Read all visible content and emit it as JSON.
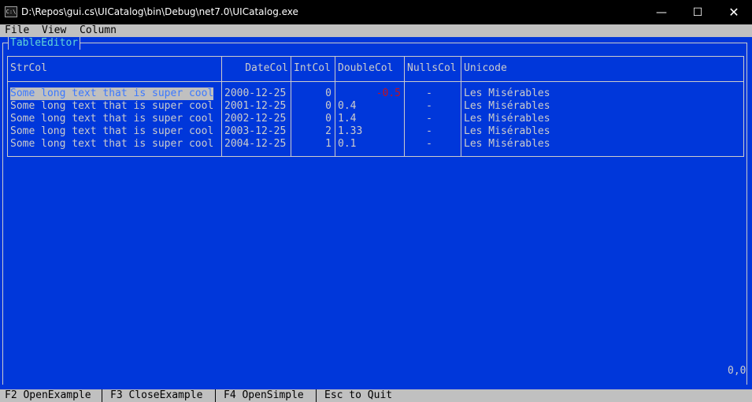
{
  "window": {
    "title": "D:\\Repos\\gui.cs\\UICatalog\\bin\\Debug\\net7.0\\UICatalog.exe",
    "icon_label": "C:\\",
    "minimize": "—",
    "maximize": "☐",
    "close": "✕"
  },
  "menu": [
    "File",
    "View",
    "Column"
  ],
  "frame_title": "TableEditor",
  "table": {
    "columns": [
      "StrCol",
      "DateCol",
      "IntCol",
      "DoubleCol",
      "NullsCol",
      "Unicode"
    ],
    "rows": [
      [
        "Some long text that is super cool",
        "2000-12-25",
        "0",
        "-0.5",
        "-",
        "Les Misérables"
      ],
      [
        "Some long text that is super cool",
        "2001-12-25",
        "0",
        "0.4",
        "-",
        "Les Misérables"
      ],
      [
        "Some long text that is super cool",
        "2002-12-25",
        "0",
        "1.4",
        "-",
        "Les Misérables"
      ],
      [
        "Some long text that is super cool",
        "2003-12-25",
        "2",
        "1.33",
        "-",
        "Les Misérables"
      ],
      [
        "Some long text that is super cool",
        "2004-12-25",
        "1",
        "0.1",
        "-",
        "Les Misérables"
      ]
    ]
  },
  "cursor_position": "0,0",
  "status": [
    "F2 OpenExample",
    "F3 CloseExample",
    "F4 OpenSimple",
    "Esc to Quit"
  ],
  "colors": {
    "background": "#0037da",
    "foreground": "#cccccc",
    "selection_bg": "#c0c0c0",
    "selection_fg": "#3b78ff",
    "negative": "#c50f1f",
    "title_accent": "#61d6d6"
  }
}
